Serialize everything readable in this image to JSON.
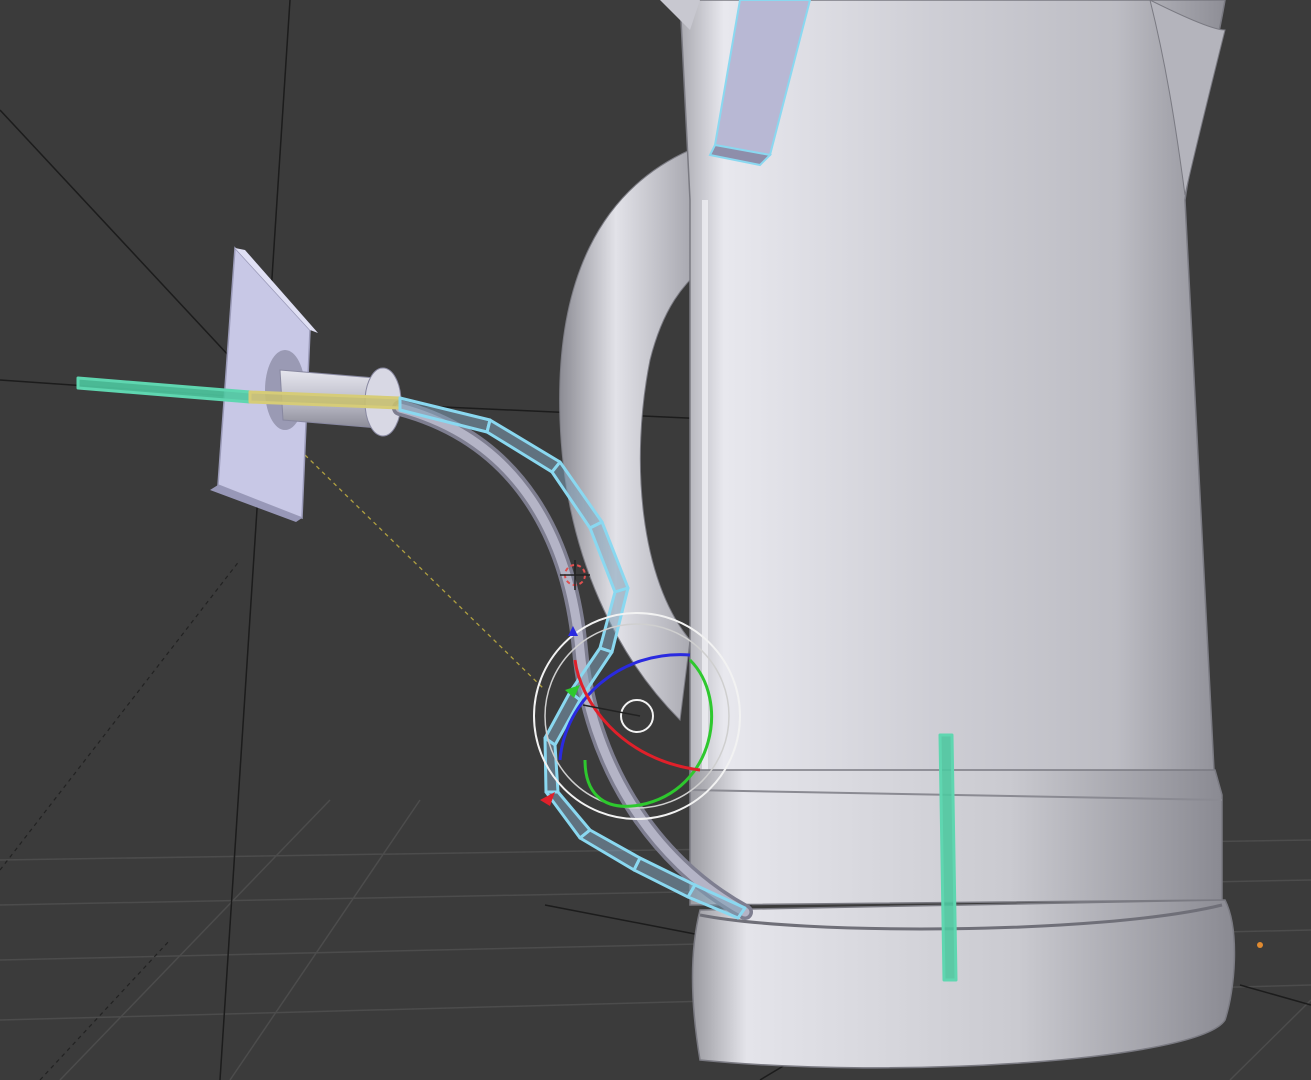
{
  "app": {
    "name": "3D viewport"
  },
  "viewport": {
    "background": "#3b3b3b",
    "grid_color": "#4a4a4a",
    "selection_color": "#8ad8f0",
    "active_bone_color": "#5fd6b0",
    "axis_x_color": "#e0202a",
    "axis_y_color": "#2ec82e",
    "axis_z_color": "#2a2ae0"
  },
  "objects": {
    "kettle_body": {
      "icon": "kettle-body-mesh",
      "color": "#d4d4da"
    },
    "kettle_handle": {
      "icon": "kettle-handle-mesh",
      "color": "#c8c8d0"
    },
    "wall_plate": {
      "icon": "wall-socket-plate-mesh",
      "color": "#c8c8e8"
    },
    "cable": {
      "icon": "power-cable-mesh",
      "color": "#a8a8b8"
    },
    "armature": {
      "icon": "armature-bones",
      "segments": 14
    },
    "gizmo": {
      "icon": "rotate-manipulator",
      "mode": "rotate"
    },
    "cursor_3d": {
      "icon": "3d-cursor"
    }
  }
}
